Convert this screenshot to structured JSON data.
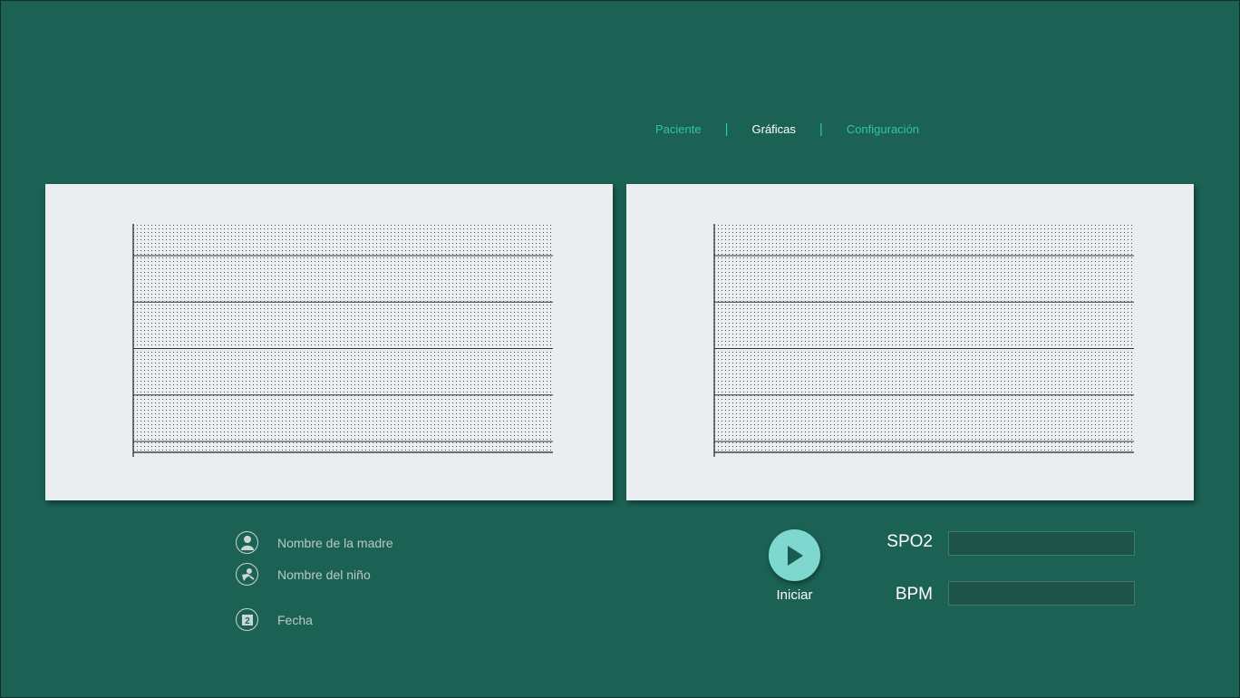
{
  "nav": {
    "items": [
      {
        "label": "Paciente",
        "active": false
      },
      {
        "label": "Gráficas",
        "active": true
      },
      {
        "label": "Configuración",
        "active": false
      }
    ],
    "separator": "|"
  },
  "charts": [
    {
      "name": "left-plot",
      "horizontal_lines": 5
    },
    {
      "name": "right-plot",
      "horizontal_lines": 5
    }
  ],
  "patient": {
    "mother_name_label": "Nombre de la madre",
    "child_name_label": "Nombre del niño",
    "date_label": "Fecha",
    "calendar_day": "2",
    "icons": [
      "person-icon",
      "baby-icon",
      "calendar-icon"
    ]
  },
  "controls": {
    "start_label": "Iniciar",
    "play_icon": "play-icon"
  },
  "readouts": {
    "spo2_label": "SPO2",
    "bpm_label": "BPM",
    "spo2_value": "",
    "bpm_value": ""
  },
  "colors": {
    "background": "#1b6255",
    "accent": "#2fc4a4",
    "panel": "#eaeef0",
    "play_button": "#7ed8cf"
  }
}
